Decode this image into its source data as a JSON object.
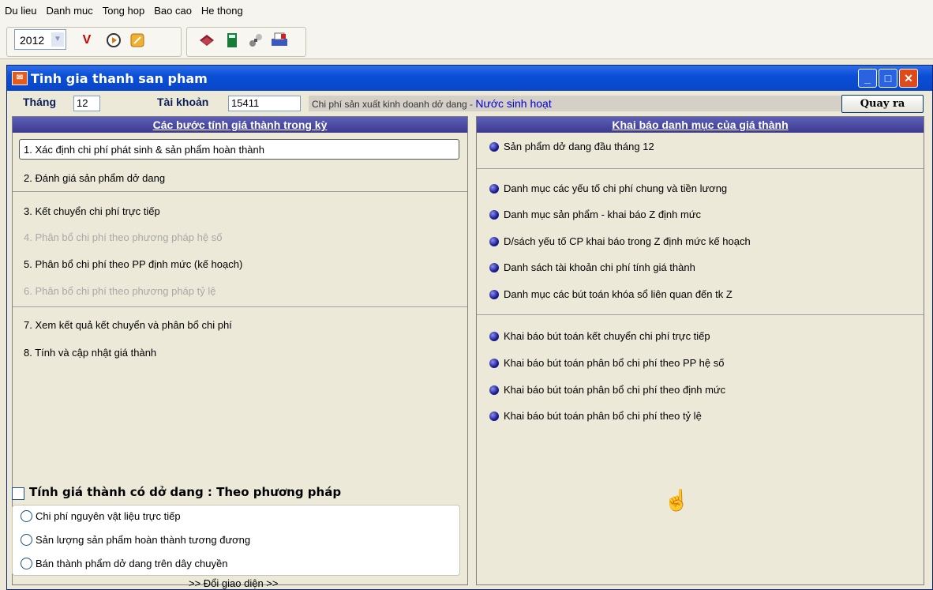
{
  "menu": [
    "Du lieu",
    "Danh muc",
    "Tong hop",
    "Bao cao",
    "He thong"
  ],
  "toolbar": {
    "year": "2012"
  },
  "window": {
    "title": "Tinh gia thanh san pham"
  },
  "header": {
    "thang_label": "Tháng",
    "thang_value": "12",
    "taikhoan_label": "Tài khoản",
    "taikhoan_value": "15411",
    "desc_prefix": "Chi phí sản xuất kinh doanh dở dang -",
    "desc_value": "Nước sinh hoạt",
    "quayra_label": "Quay ra"
  },
  "left": {
    "heading": "Các bước tính giá thành trong kỳ",
    "steps": [
      {
        "label": "1. Xác định chi phí phát sinh & sản phẩm hoàn thành",
        "enabled": true
      },
      {
        "label": "2. Đánh giá sản phẩm dở dang",
        "enabled": true
      },
      {
        "label": "3. Kết chuyển chi phí trực tiếp",
        "enabled": true
      },
      {
        "label": "4. Phân bổ chi phí theo phương pháp hệ số",
        "enabled": false
      },
      {
        "label": "5. Phân bổ chi phí theo PP định mức (kế hoạch)",
        "enabled": true
      },
      {
        "label": "6. Phân bổ chi phí theo phương pháp tỷ lệ",
        "enabled": false
      },
      {
        "label": "7. Xem kết quả kết chuyển và phân bổ chi phí",
        "enabled": true
      },
      {
        "label": "8. Tính và cập nhật giá thành",
        "enabled": true
      }
    ],
    "method_label": "Tính giá thành có dở dang : Theo phương pháp",
    "method_checked": false,
    "options": [
      "Chi phí nguyên vật liệu trực tiếp",
      "Sản lượng sản phẩm hoàn thành tương đương",
      "Bán thành phẩm dở dang trên dây chuyền"
    ],
    "switch_label": ">> Đổi giao diện >>"
  },
  "right": {
    "heading": "Khai báo danh mục của giá thành",
    "group1": [
      "Sản phẩm dở dang đầu tháng 12"
    ],
    "group2": [
      "Danh mục các yếu tố chi phí chung và tiền lương",
      "Danh mục sản phẩm - khai báo Z định mức",
      "D/sách yếu tố CP khai báo trong Z định mức kế hoạch",
      "Danh sách tài khoản chi phí tính giá thành",
      "Danh mục các bút toán khóa sổ liên quan đến tk Z"
    ],
    "group3": [
      "Khai báo bút toán kết chuyển chi phí trực tiếp",
      "Khai báo bút toán phân bổ chi phí theo PP hệ số",
      "Khai báo bút toán phân bổ chi phí theo định mức",
      "Khai báo bút toán phân bổ chi phí theo tỷ lệ"
    ]
  },
  "colors": {
    "title_bar": "#0a4fd8",
    "panel_header": "#3d3a8e",
    "bullet": "#1a1a90"
  }
}
